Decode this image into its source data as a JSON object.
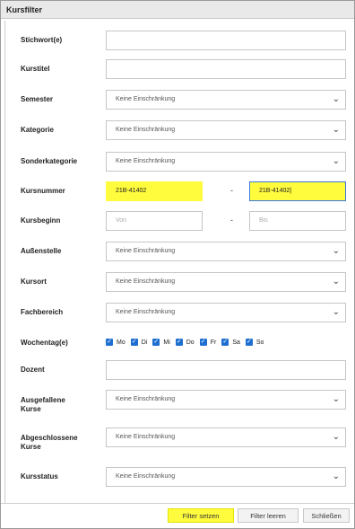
{
  "window": {
    "title": "Kursfilter"
  },
  "fields": {
    "stichwort": {
      "label": "Stichwort(e)",
      "value": ""
    },
    "kurstitel": {
      "label": "Kurstitel",
      "value": ""
    },
    "semester": {
      "label": "Semester",
      "value": "Keine Einschränkung"
    },
    "kategorie": {
      "label": "Kategorie",
      "value": "Keine Einschränkung"
    },
    "sonderkategorie": {
      "label": "Sonderkategorie",
      "value": "Keine Einschränkung"
    },
    "kursnummer": {
      "label": "Kursnummer",
      "from": "21B-41402",
      "to": "21B-41402",
      "separator": "-"
    },
    "kursbeginn": {
      "label": "Kursbeginn",
      "from_placeholder": "Von",
      "to_placeholder": "Bis",
      "separator": "-"
    },
    "aussenstelle": {
      "label": "Außenstelle",
      "value": "Keine Einschränkung"
    },
    "kursort": {
      "label": "Kursort",
      "value": "Keine Einschränkung"
    },
    "fachbereich": {
      "label": "Fachbereich",
      "value": "Keine Einschränkung"
    },
    "wochentag": {
      "label": "Wochentag(e)",
      "days": [
        "Mo",
        "Di",
        "Mi",
        "Do",
        "Fr",
        "Sa",
        "So"
      ],
      "checked": [
        true,
        true,
        true,
        true,
        true,
        true,
        true
      ]
    },
    "dozent": {
      "label": "Dozent",
      "value": ""
    },
    "ausgefallene": {
      "label": "Ausgefallene Kurse",
      "value": "Keine Einschränkung"
    },
    "abgeschlossene": {
      "label": "Abgeschlossene Kurse",
      "value": "Keine Einschränkung"
    },
    "kursstatus": {
      "label": "Kursstatus",
      "value": "Keine Einschränkung"
    }
  },
  "buttons": {
    "apply": "Filter setzen",
    "clear": "Filter leeren",
    "close": "Schließen"
  },
  "colors": {
    "highlight": "#fffb3d",
    "checkbox": "#1f6fd1",
    "focus_border": "#3a78d8"
  },
  "icons": {
    "select_arrow": "chevron-down-icon",
    "checkbox": "checkmark-icon"
  }
}
